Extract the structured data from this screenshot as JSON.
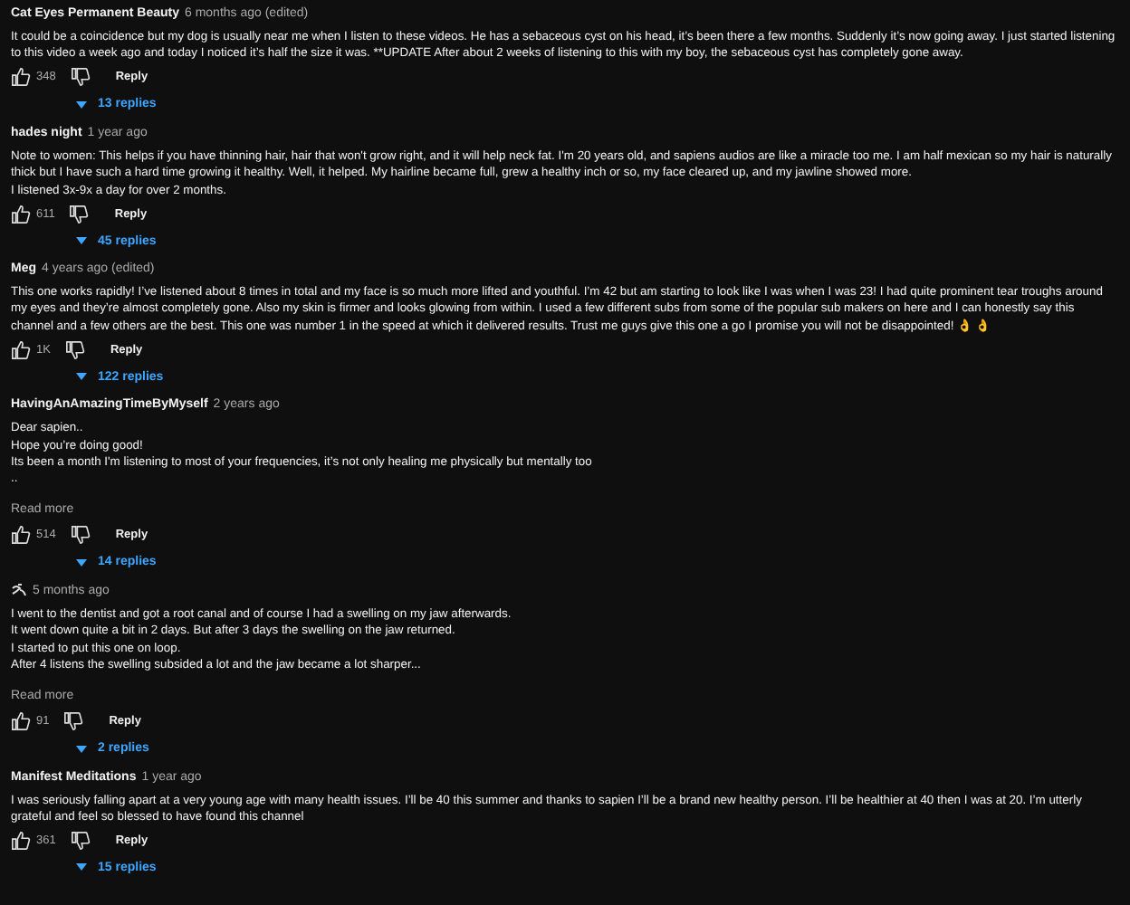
{
  "comments": [
    {
      "author": "Cat Eyes Permanent Beauty",
      "time": "6 months ago (edited)",
      "body": [
        "It could be a coincidence but my dog is usually near me when I listen to these videos. He has a sebaceous cyst on his head, it’s been there a few months. Suddenly it’s now going away. I just started listening to this video a week ago and today I noticed it’s half the size it was. **UPDATE After about 2 weeks of listening to this with my boy, the sebaceous cyst has completely gone away."
      ],
      "likes": "348",
      "reply": "Reply",
      "replies": "13 replies"
    },
    {
      "author": "hades night",
      "time": "1 year ago",
      "body": [
        "Note to women: This helps if you have thinning hair, hair that won't grow right, and it will help neck fat. I'm 20 years old, and sapiens audios are like a miracle too me. I am half mexican so my hair is naturally thick but I have such a hard time growing it healthy. Well, it helped. My hairline became full, grew a healthy inch or so, my face cleared up, and my jawline showed more.",
        "I listened 3x-9x a day for over 2 months."
      ],
      "likes": "611",
      "reply": "Reply",
      "replies": "45 replies"
    },
    {
      "author": "Meg",
      "time": "4 years ago (edited)",
      "body": [
        "This one works rapidly! I’ve listened about 8 times in total and my face is so much more lifted and youthful. I’m 42 but am starting to look like I was when I was 23! I had quite prominent tear troughs around my eyes and they’re almost completely gone. Also my skin is firmer and looks glowing from within. I used a few different subs from some of the popular sub makers on here and I can honestly say this channel and a few others are the best. This one was number 1 in the speed at which it delivered results. Trust me guys give this one a go I promise you will not be disappointed! 👌 👌"
      ],
      "likes": "1K",
      "reply": "Reply",
      "replies": "122 replies"
    },
    {
      "author": "HavingAnAmazingTimeByMyself",
      "time": "2 years ago",
      "body": [
        "Dear sapien..",
        "Hope you’re doing good!",
        "Its been a month I'm listening to most of your frequencies, it’s not only healing me physically but mentally too",
        ".."
      ],
      "read_more": "Read more",
      "likes": "514",
      "reply": "Reply",
      "replies": "14 replies"
    },
    {
      "time": "5 months ago",
      "body": [
        "I went to the dentist and got a root canal and of course I had a swelling on my jaw afterwards.",
        "It went down quite a bit in 2 days. But after 3 days the swelling on the jaw returned.",
        "I started to put this one on loop.",
        "After 4 listens the swelling subsided a lot and the jaw became a lot sharper..."
      ],
      "read_more": "Read more",
      "likes": "91",
      "reply": "Reply",
      "replies": "2 replies"
    },
    {
      "author": "Manifest Meditations",
      "time": "1 year ago",
      "body": [
        "I was seriously falling apart at a very young age with many health issues. I’ll be 40 this summer and thanks to sapien I’ll be a brand new healthy person. I’ll be healthier at 40 then I was at 20. I’m utterly grateful and feel so blessed to have found this channel"
      ],
      "likes": "361",
      "reply": "Reply",
      "replies": "15 replies"
    }
  ]
}
